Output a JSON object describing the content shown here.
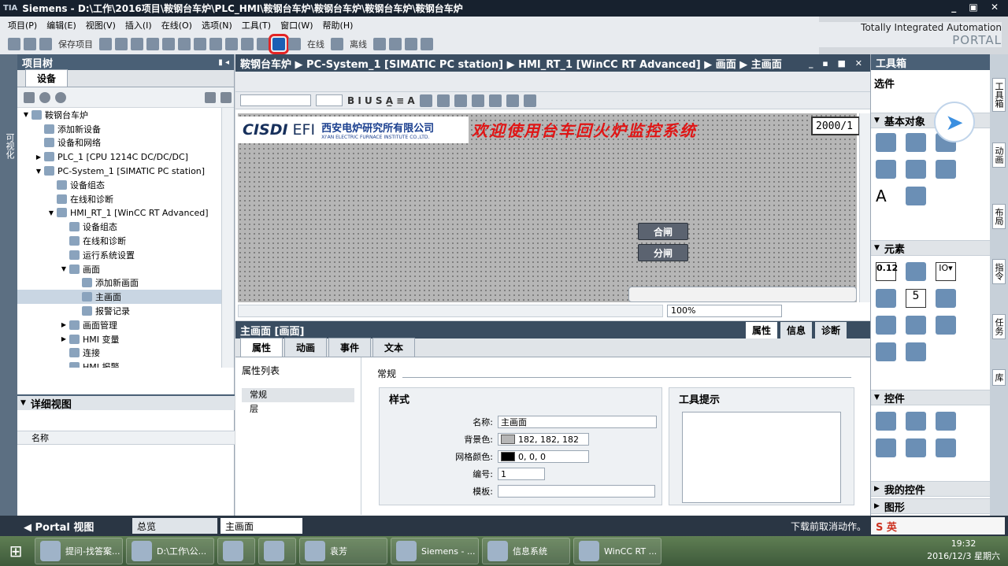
{
  "window": {
    "title": "Siemens  -  D:\\工作\\2016项目\\鞍钢台车炉\\PLC_HMI\\鞍钢台车炉\\鞍钢台车炉\\鞍钢台车炉\\鞍钢台车炉",
    "logo": "TIA",
    "buttons": "_ ▣ ✕"
  },
  "menu": [
    "项目(P)",
    "编辑(E)",
    "视图(V)",
    "插入(I)",
    "在线(O)",
    "选项(N)",
    "工具(T)",
    "窗口(W)",
    "帮助(H)"
  ],
  "toolbar": {
    "save_label": "保存项目",
    "online": "在线",
    "offline": "离线"
  },
  "brand": {
    "line1": "Totally Integrated Automation",
    "line2": "PORTAL"
  },
  "left_vtab": "可视化",
  "project_tree": {
    "title": "项目树",
    "tab": "设备",
    "items": [
      {
        "label": "鞍钢台车炉",
        "arrow": "▼",
        "indent": 0
      },
      {
        "label": "添加新设备",
        "arrow": "",
        "indent": 1
      },
      {
        "label": "设备和网络",
        "arrow": "",
        "indent": 1
      },
      {
        "label": "PLC_1 [CPU 1214C DC/DC/DC]",
        "arrow": "▶",
        "indent": 1
      },
      {
        "label": "PC-System_1 [SIMATIC PC station]",
        "arrow": "▼",
        "indent": 1
      },
      {
        "label": "设备组态",
        "arrow": "",
        "indent": 2
      },
      {
        "label": "在线和诊断",
        "arrow": "",
        "indent": 2
      },
      {
        "label": "HMI_RT_1 [WinCC RT Advanced]",
        "arrow": "▼",
        "indent": 2
      },
      {
        "label": "设备组态",
        "arrow": "",
        "indent": 3
      },
      {
        "label": "在线和诊断",
        "arrow": "",
        "indent": 3
      },
      {
        "label": "运行系统设置",
        "arrow": "",
        "indent": 3
      },
      {
        "label": "画面",
        "arrow": "▼",
        "indent": 3
      },
      {
        "label": "添加新画面",
        "arrow": "",
        "indent": 4
      },
      {
        "label": "主画面",
        "arrow": "",
        "indent": 4,
        "selected": true
      },
      {
        "label": "报警记录",
        "arrow": "",
        "indent": 4
      },
      {
        "label": "画面管理",
        "arrow": "▶",
        "indent": 3
      },
      {
        "label": "HMI 变量",
        "arrow": "▶",
        "indent": 3
      },
      {
        "label": "连接",
        "arrow": "",
        "indent": 3
      },
      {
        "label": "HMI 报警",
        "arrow": "",
        "indent": 3
      }
    ],
    "detail_title": "详细视图",
    "detail_column": "名称"
  },
  "editor": {
    "breadcrumb": "鞍钢台车炉  ▶  PC-System_1 [SIMATIC PC station]  ▶  HMI_RT_1 [WinCC RT Advanced]  ▶  画面  ▶  主画面",
    "window_buttons": "_ ▪ ■ ✕",
    "format_glyphs": "B  I  U  S  A̲  ≡  A  ",
    "logo_cisdi": "CISDI",
    "logo_efi": "EFI",
    "logo_cn": "西安电炉研究所有限公司",
    "logo_en": "XI'AN ELECTRIC FURNACE INSTITUTE CO.,LTD.",
    "welcome": "欢迎使用台车回火炉监控系统",
    "date": "2000/1",
    "btn_close": "合闸",
    "btn_open": "分闸",
    "zoom": "100%"
  },
  "properties": {
    "title": "主画面 [画面]",
    "right_tabs": [
      "属性",
      "信息",
      "诊断"
    ],
    "tabs": [
      "属性",
      "动画",
      "事件",
      "文本"
    ],
    "list_header": "属性列表",
    "list_items": [
      "常规",
      "层"
    ],
    "section": "常规",
    "style_caption": "样式",
    "fields": [
      {
        "label": "名称:",
        "value": "主画面"
      },
      {
        "label": "背景色:",
        "value": "182, 182, 182",
        "color": "#b6b6b6"
      },
      {
        "label": "网格颜色:",
        "value": "0, 0, 0",
        "color": "#000000"
      },
      {
        "label": "编号:",
        "value": "1"
      },
      {
        "label": "模板:",
        "value": ""
      }
    ],
    "tooltip_caption": "工具提示"
  },
  "toolbox": {
    "title": "工具箱",
    "options": "选件",
    "sections": [
      "基本对象",
      "元素",
      "控件",
      "我的控件",
      "图形"
    ],
    "labels_shown": {
      "elem_value": "0.12",
      "elem_io": "IO▾",
      "elem_five": "5",
      "basic_text": "A"
    }
  },
  "right_vtabs": [
    "工具箱",
    "动画",
    "布局",
    "指令",
    "任务",
    "库"
  ],
  "status": {
    "portal": "Portal 视图",
    "tab1": "总览",
    "tab2": "主画面",
    "message": "下载前取消动作。",
    "ime": "S 英"
  },
  "taskbar": {
    "tasks": [
      "提问-找答案...",
      "D:\\工作\\公...",
      "",
      "",
      "袁芳",
      "Siemens - ...",
      "信息系统",
      "WinCC RT ..."
    ],
    "time": "19:32",
    "date": "2016/12/3 星期六"
  }
}
